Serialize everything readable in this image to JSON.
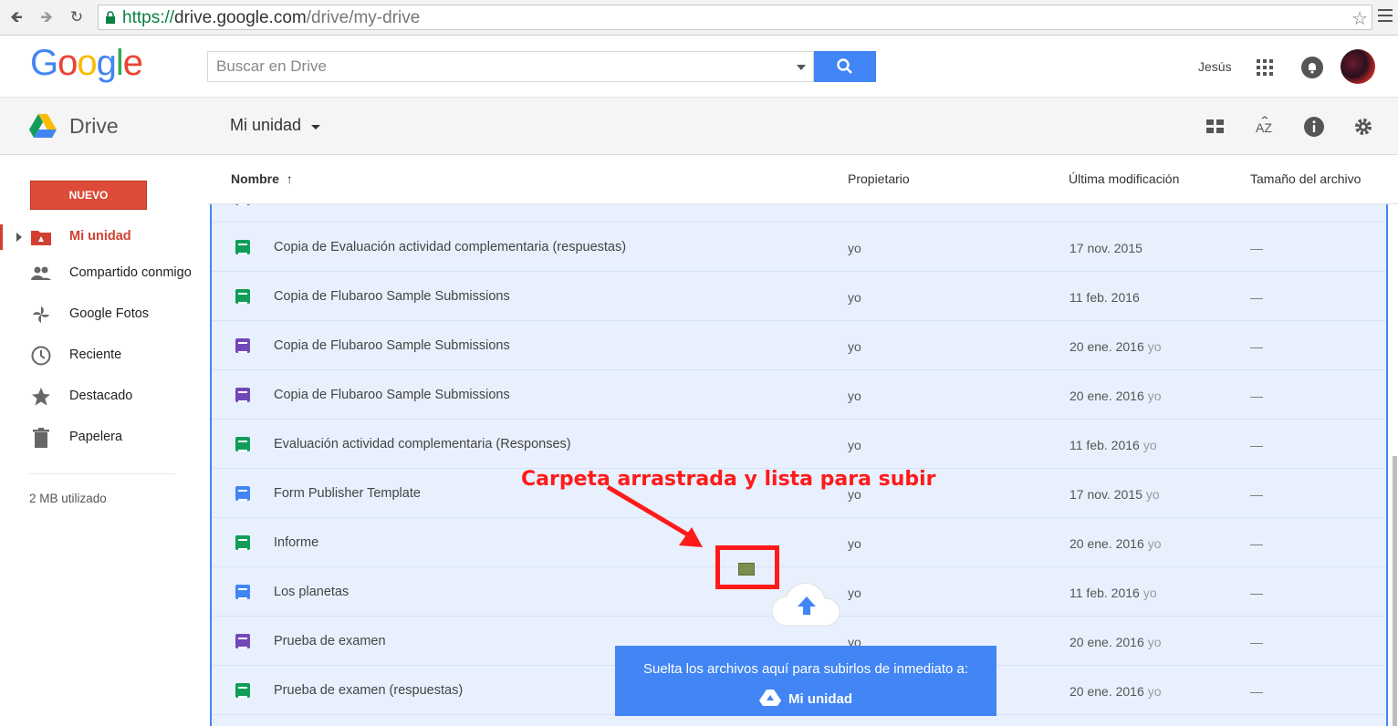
{
  "browser": {
    "url_scheme": "https://",
    "url_host": "drive.google.com",
    "url_path": "/drive/my-drive"
  },
  "header": {
    "logo": "Google",
    "search_placeholder": "Buscar en Drive",
    "user_name": "Jesús"
  },
  "subheader": {
    "app_label": "Drive",
    "folder_title": "Mi unidad"
  },
  "sidebar": {
    "new_button": "NUEVO",
    "items": [
      {
        "label": "Mi unidad",
        "icon": "my-drive-icon",
        "active": true
      },
      {
        "label": "Compartido conmigo",
        "icon": "shared-people-icon"
      },
      {
        "label": "Google Fotos",
        "icon": "photos-pinwheel-icon"
      },
      {
        "label": "Reciente",
        "icon": "clock-icon"
      },
      {
        "label": "Destacado",
        "icon": "star-icon"
      },
      {
        "label": "Papelera",
        "icon": "trash-icon"
      }
    ],
    "storage": "2 MB utilizado"
  },
  "columns": {
    "name": "Nombre",
    "owner": "Propietario",
    "modified": "Última modificación",
    "size": "Tamaño del archivo"
  },
  "files": [
    {
      "name": "Copia de Evaluación actividad complementaria (respuestas)",
      "type": "sheet",
      "owner": "yo",
      "modified": "17 nov. 2015",
      "by": "",
      "size": "—"
    },
    {
      "name": "Copia de Flubaroo Sample Submissions",
      "type": "sheet",
      "owner": "yo",
      "modified": "11 feb. 2016",
      "by": "",
      "size": "—"
    },
    {
      "name": "Copia de Flubaroo Sample Submissions",
      "type": "form",
      "owner": "yo",
      "modified": "20 ene. 2016",
      "by": "yo",
      "size": "—"
    },
    {
      "name": "Copia de Flubaroo Sample Submissions",
      "type": "form",
      "owner": "yo",
      "modified": "20 ene. 2016",
      "by": "yo",
      "size": "—"
    },
    {
      "name": "Evaluación actividad complementaria (Responses)",
      "type": "sheet",
      "owner": "yo",
      "modified": "11 feb. 2016",
      "by": "yo",
      "size": "—"
    },
    {
      "name": "Form Publisher Template",
      "type": "doc",
      "owner": "yo",
      "modified": "17 nov. 2015",
      "by": "yo",
      "size": "—"
    },
    {
      "name": "Informe",
      "type": "sheet",
      "owner": "yo",
      "modified": "20 ene. 2016",
      "by": "yo",
      "size": "—"
    },
    {
      "name": "Los planetas",
      "type": "doc",
      "owner": "yo",
      "modified": "11 feb. 2016",
      "by": "yo",
      "size": "—"
    },
    {
      "name": "Prueba de examen",
      "type": "form",
      "owner": "yo",
      "modified": "20 ene. 2016",
      "by": "yo",
      "size": "—"
    },
    {
      "name": "Prueba de examen (respuestas)",
      "type": "sheet",
      "owner": "yo",
      "modified": "20 ene. 2016",
      "by": "yo",
      "size": "—"
    }
  ],
  "annotation": "Carpeta arrastrada y lista para subir",
  "drop_toast": {
    "message": "Suelta los archivos aquí para subirlos de inmediato a:",
    "destination": "Mi unidad"
  },
  "colors": {
    "accent_blue": "#4285f4",
    "new_red": "#dd4b39",
    "annotation_red": "#ff1a1a",
    "drop_bg": "#e8f0fe"
  }
}
